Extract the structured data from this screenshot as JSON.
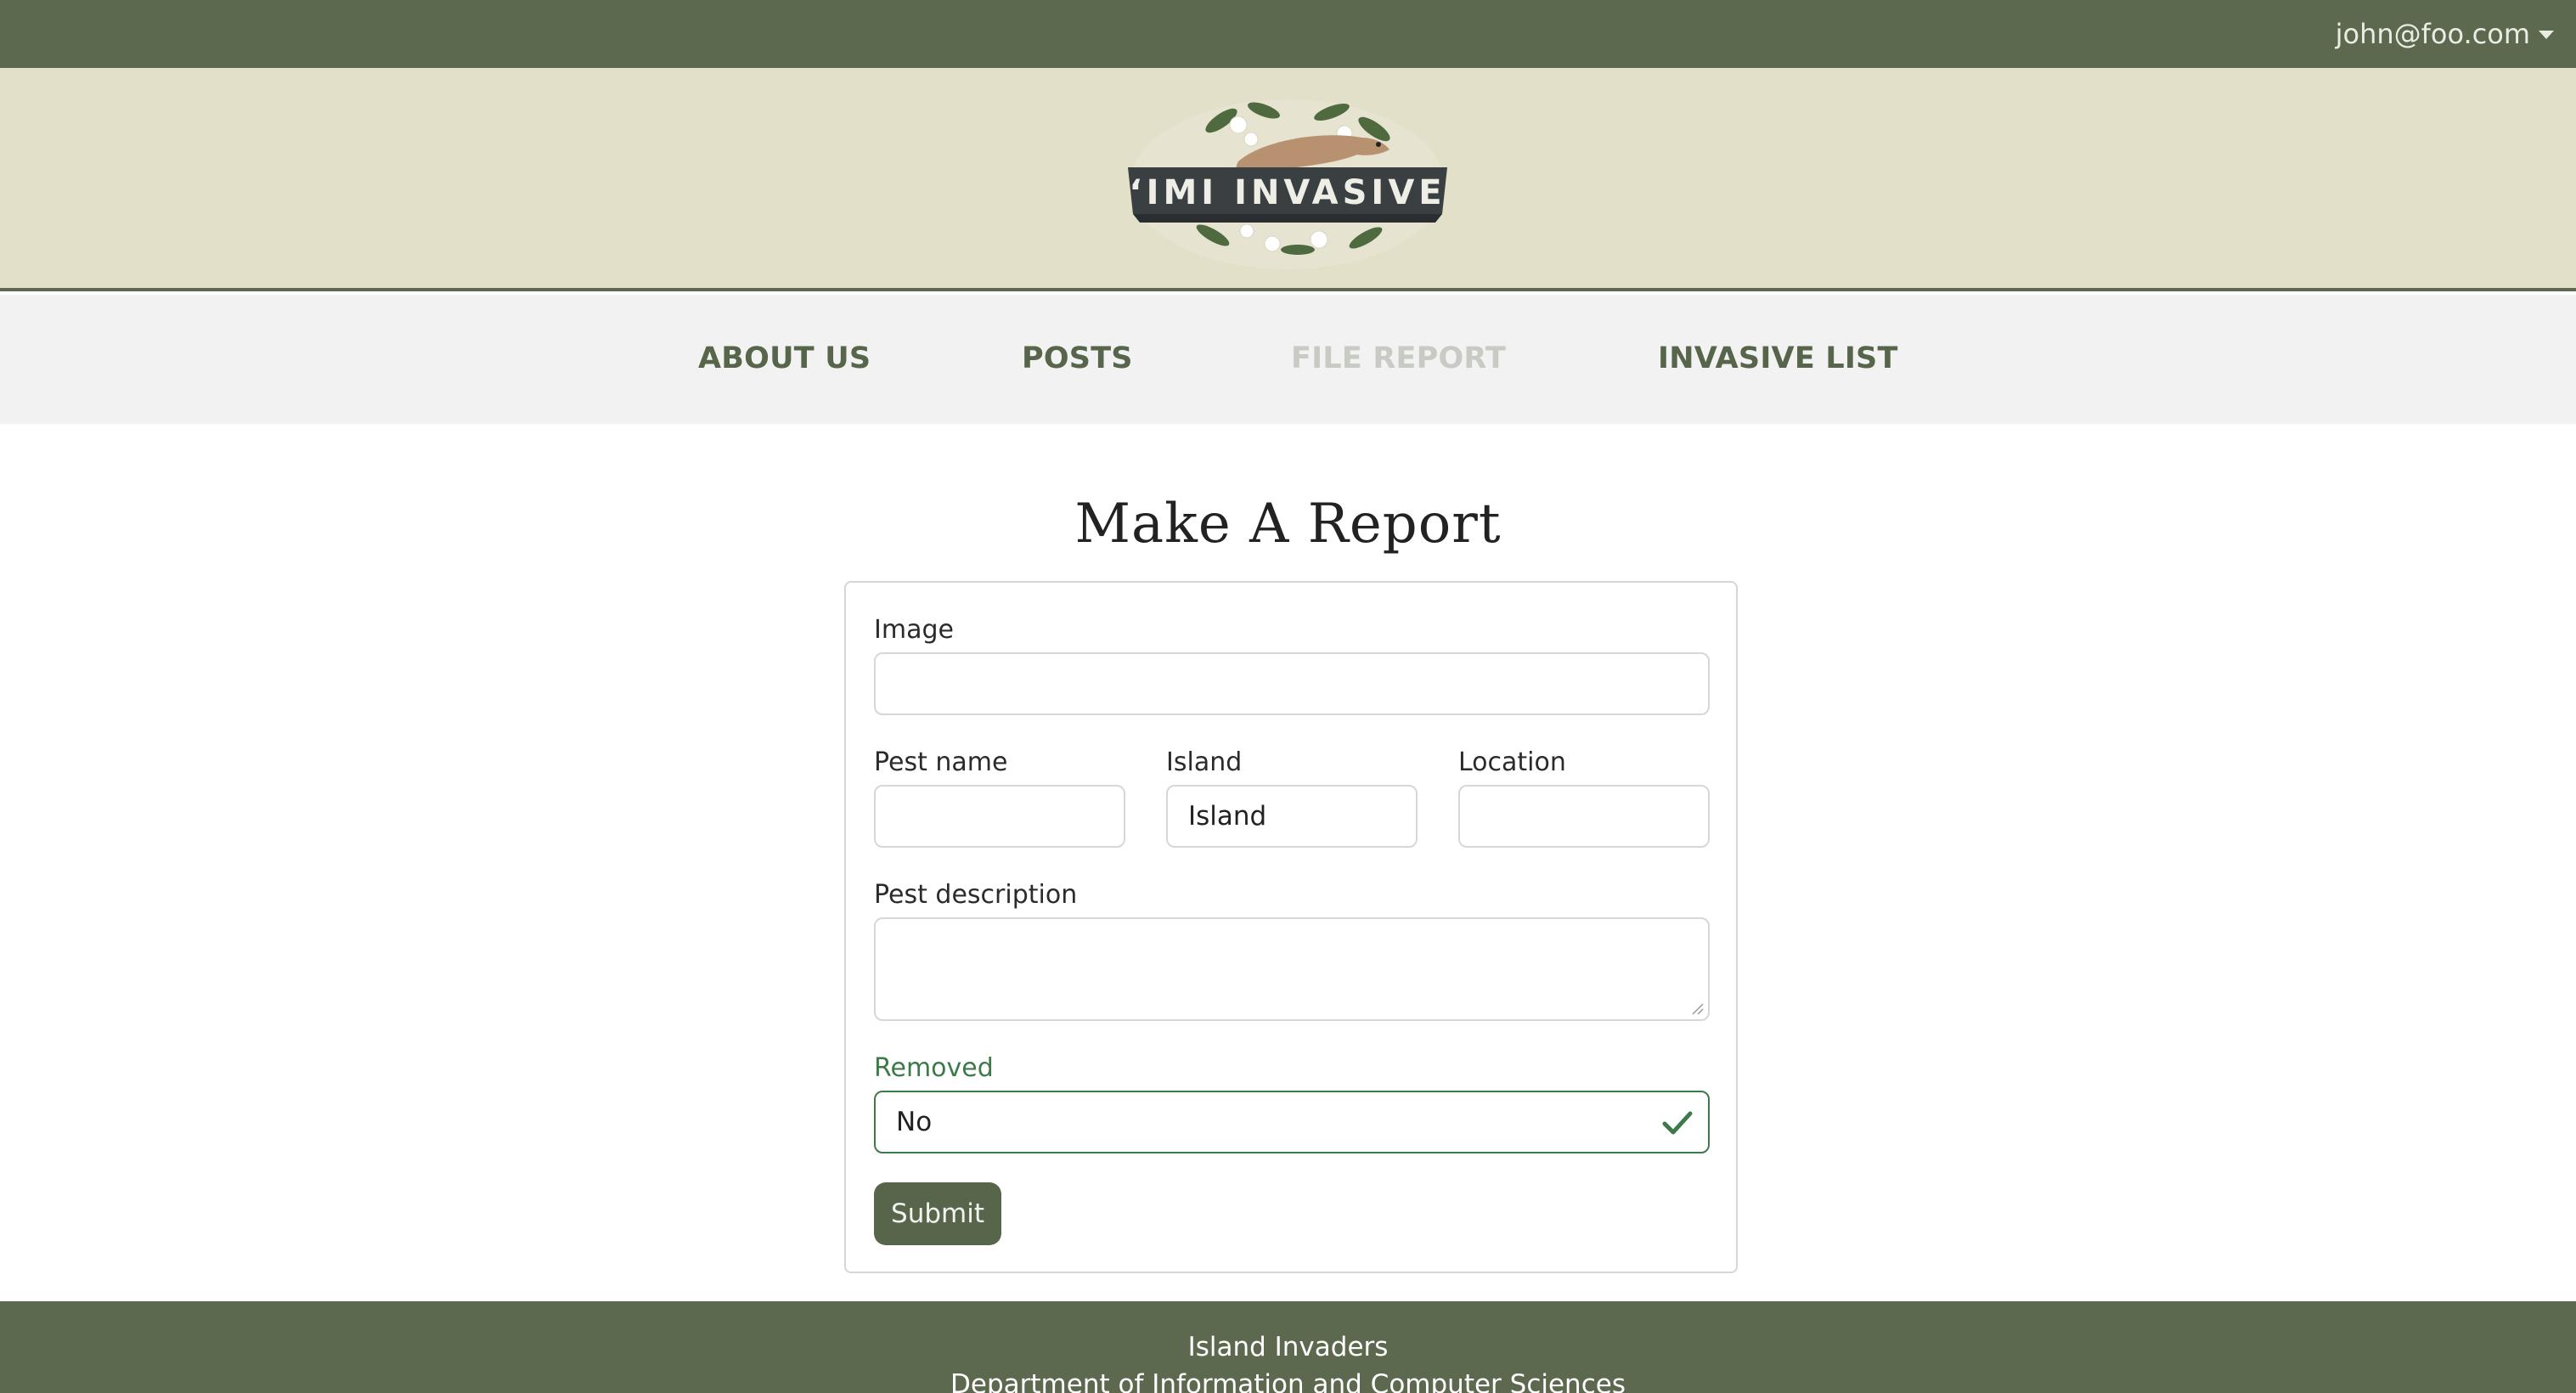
{
  "topbar": {
    "user_email": "john@foo.com"
  },
  "header": {
    "logo_text": "‘IMI INVASIVE"
  },
  "nav": {
    "items": [
      {
        "label": "ABOUT US",
        "active": true
      },
      {
        "label": "POSTS",
        "active": true
      },
      {
        "label": "FILE REPORT",
        "active": false
      },
      {
        "label": "INVASIVE LIST",
        "active": true
      }
    ]
  },
  "main": {
    "title": "Make A Report",
    "form": {
      "image": {
        "label": "Image",
        "value": ""
      },
      "pest_name": {
        "label": "Pest name",
        "value": ""
      },
      "island": {
        "label": "Island",
        "value": "Island"
      },
      "location": {
        "label": "Location",
        "value": ""
      },
      "pest_description": {
        "label": "Pest description",
        "value": ""
      },
      "removed": {
        "label": "Removed",
        "value": "No"
      },
      "submit_label": "Submit"
    }
  },
  "footer": {
    "line1": "Island Invaders",
    "line2": "Department of Information and Computer Sciences"
  },
  "colors": {
    "brand_dark": "#5d694e",
    "header_bg": "#e2e0c9",
    "nav_bg": "#f2f2f2",
    "valid_green": "#3c7a4a",
    "button_bg": "#57654b"
  }
}
